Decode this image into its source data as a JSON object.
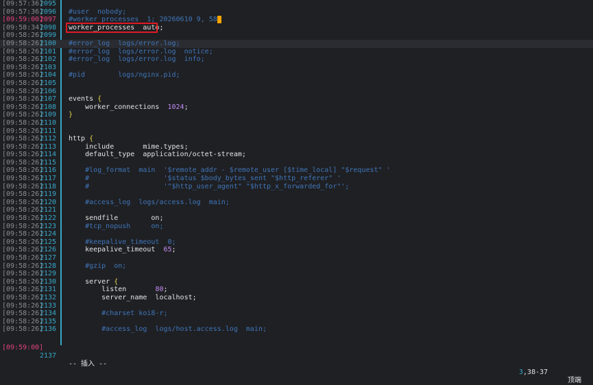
{
  "lines": [
    {
      "ts": "[09:57:36]",
      "ln": "2095",
      "text": ""
    },
    {
      "ts": "[09:57:36]",
      "ln": "2096",
      "text": "#user  nobody;",
      "kind": "cmt"
    },
    {
      "ts": "[09:59:00]",
      "ln": "2097",
      "text": "#worker_processes  1; 20260610 9, 58",
      "kind": "cmt",
      "current": true
    },
    {
      "ts": "[09:58:34]",
      "ln": "2098",
      "text": "worker_processes  auto;"
    },
    {
      "ts": "[09:58:26]",
      "ln": "2099",
      "text": ""
    },
    {
      "ts": "[09:58:26]",
      "ln": "2100",
      "text": "#error_log  logs/error.log;",
      "kind": "cmt",
      "cursorline": true
    },
    {
      "ts": "[09:58:26]",
      "ln": "2101",
      "text": "#error_log  logs/error.log  notice;",
      "kind": "cmt"
    },
    {
      "ts": "[09:58:26]",
      "ln": "2102",
      "text": "#error_log  logs/error.log  info;",
      "kind": "cmt"
    },
    {
      "ts": "[09:58:26]",
      "ln": "2103",
      "text": ""
    },
    {
      "ts": "[09:58:26]",
      "ln": "2104",
      "text": "#pid        logs/nginx.pid;",
      "kind": "cmt"
    },
    {
      "ts": "[09:58:26]",
      "ln": "2105",
      "text": ""
    },
    {
      "ts": "[09:58:26]",
      "ln": "2106",
      "text": ""
    },
    {
      "ts": "[09:58:26]",
      "ln": "2107",
      "text": "events ",
      "brace": "{"
    },
    {
      "ts": "[09:58:26]",
      "ln": "2108",
      "text": "    worker_connections  ",
      "num": "1024",
      "suffix": ";"
    },
    {
      "ts": "[09:58:26]",
      "ln": "2109",
      "text": "",
      "brace": "}"
    },
    {
      "ts": "[09:58:26]",
      "ln": "2110",
      "text": ""
    },
    {
      "ts": "[09:58:26]",
      "ln": "2111",
      "text": ""
    },
    {
      "ts": "[09:58:26]",
      "ln": "2112",
      "text": "http ",
      "brace": "{"
    },
    {
      "ts": "[09:58:26]",
      "ln": "2113",
      "text": "    include       mime.types;"
    },
    {
      "ts": "[09:58:26]",
      "ln": "2114",
      "text": "    default_type  application/octet-stream;"
    },
    {
      "ts": "[09:58:26]",
      "ln": "2115",
      "text": ""
    },
    {
      "ts": "[09:58:26]",
      "ln": "2116",
      "text": "    #log_format  main  '$remote_addr - $remote_user [$time_local] \"$request\" '",
      "kind": "cmt"
    },
    {
      "ts": "[09:58:26]",
      "ln": "2117",
      "text": "    #                  '$status $body_bytes_sent \"$http_referer\" '",
      "kind": "cmt"
    },
    {
      "ts": "[09:58:26]",
      "ln": "2118",
      "text": "    #                  '\"$http_user_agent\" \"$http_x_forwarded_for\"';",
      "kind": "cmt"
    },
    {
      "ts": "[09:58:26]",
      "ln": "2119",
      "text": ""
    },
    {
      "ts": "[09:58:26]",
      "ln": "2120",
      "text": "    #access_log  logs/access.log  main;",
      "kind": "cmt"
    },
    {
      "ts": "[09:58:26]",
      "ln": "2121",
      "text": ""
    },
    {
      "ts": "[09:58:26]",
      "ln": "2122",
      "text": "    sendfile        on;"
    },
    {
      "ts": "[09:58:26]",
      "ln": "2123",
      "text": "    #tcp_nopush     on;",
      "kind": "cmt"
    },
    {
      "ts": "[09:58:26]",
      "ln": "2124",
      "text": ""
    },
    {
      "ts": "[09:58:26]",
      "ln": "2125",
      "text": "    #keepalive_timeout  0;",
      "kind": "cmt"
    },
    {
      "ts": "[09:58:26]",
      "ln": "2126",
      "text": "    keepalive_timeout  ",
      "num": "65",
      "suffix": ";"
    },
    {
      "ts": "[09:58:26]",
      "ln": "2127",
      "text": ""
    },
    {
      "ts": "[09:58:26]",
      "ln": "2128",
      "text": "    #gzip  on;",
      "kind": "cmt"
    },
    {
      "ts": "[09:58:26]",
      "ln": "2129",
      "text": ""
    },
    {
      "ts": "[09:58:26]",
      "ln": "2130",
      "text": "    server ",
      "brace": "{"
    },
    {
      "ts": "[09:58:26]",
      "ln": "2131",
      "text": "        listen       ",
      "num": "80",
      "suffix": ";"
    },
    {
      "ts": "[09:58:26]",
      "ln": "2132",
      "text": "        server_name  localhost;"
    },
    {
      "ts": "[09:58:26]",
      "ln": "2133",
      "text": ""
    },
    {
      "ts": "[09:58:26]",
      "ln": "2134",
      "text": "        #charset koi8-r;",
      "kind": "cmt"
    },
    {
      "ts": "[09:58:26]",
      "ln": "2135",
      "text": ""
    },
    {
      "ts": "[09:58:26]",
      "ln": "2136",
      "text": "        #access_log  logs/host.access.log  main;",
      "kind": "cmt"
    }
  ],
  "status": {
    "ts": "[09:59:00]",
    "ln": "2137",
    "mode": "-- 插入 --",
    "pos1": "3",
    "pos2": ",38-37",
    "scroll": "顶端"
  },
  "colors": {
    "background": "#1f2024",
    "line_number": "#37a9c9",
    "current_line_number": "#e0447a",
    "comment": "#3f76b8",
    "number": "#c58cf4",
    "brace": "#e8d84a",
    "cursor": "#ffa500",
    "highlight_box": "#e01b24"
  }
}
